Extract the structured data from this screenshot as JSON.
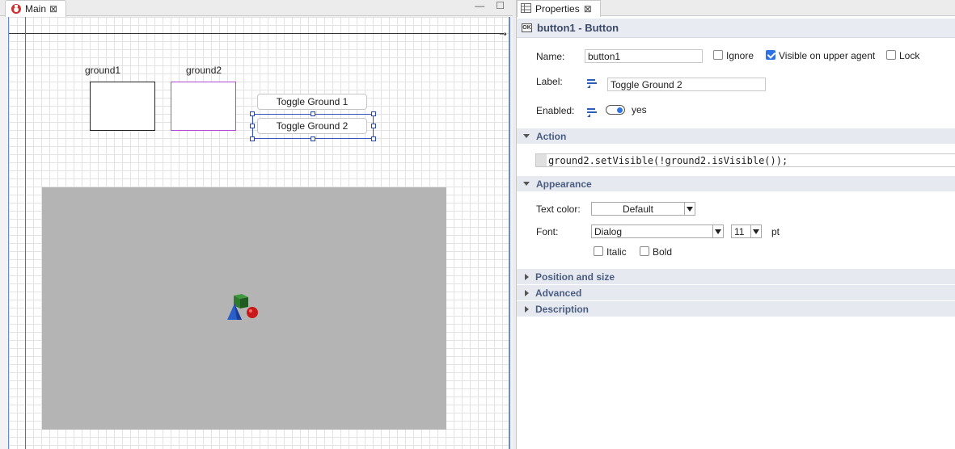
{
  "editor": {
    "tab_label": "Main",
    "canvas": {
      "ground1_label": "ground1",
      "ground2_label": "ground2",
      "button1_label": "Toggle Ground 1",
      "button2_label": "Toggle Ground 2"
    }
  },
  "properties": {
    "tab_label": "Properties",
    "title": "button1 - Button",
    "title_icon_text": "OK",
    "name_label": "Name:",
    "name_value": "button1",
    "ignore_label": "Ignore",
    "ignore_checked": false,
    "visible_label": "Visible on upper agent",
    "visible_checked": true,
    "lock_label": "Lock",
    "lock_checked": false,
    "label_label": "Label:",
    "label_value": "Toggle Ground 2",
    "enabled_label": "Enabled:",
    "enabled_value": "yes",
    "sections": {
      "action": "Action",
      "appearance": "Appearance",
      "position": "Position and size",
      "advanced": "Advanced",
      "description": "Description"
    },
    "action_code": "ground2.setVisible(!ground2.isVisible());",
    "text_color_label": "Text color:",
    "text_color_value": "Default",
    "font_label": "Font:",
    "font_value": "Dialog",
    "font_size_value": "11",
    "font_unit": "pt",
    "italic_label": "Italic",
    "bold_label": "Bold"
  }
}
